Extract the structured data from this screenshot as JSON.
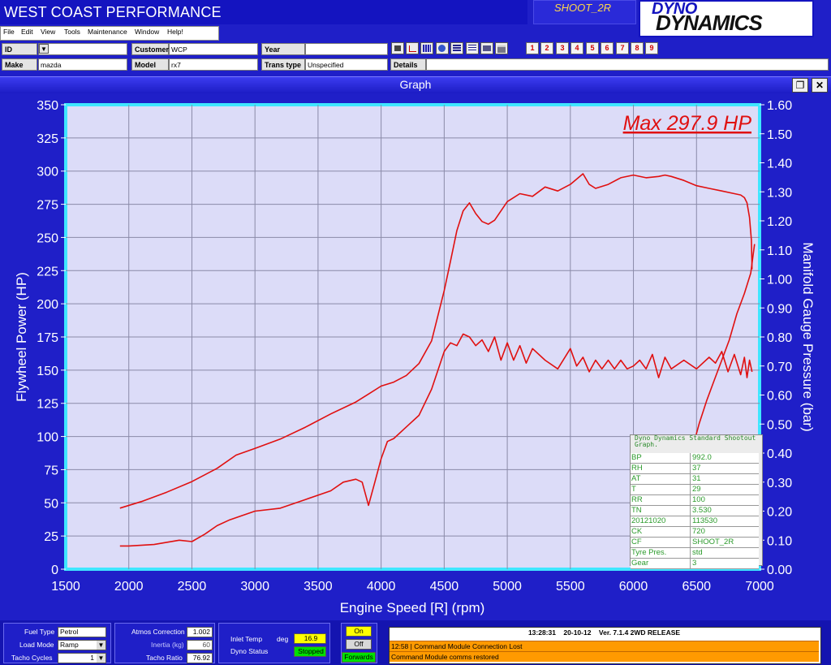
{
  "app": {
    "title": "WEST COAST PERFORMANCE",
    "shoot_label": "SHOOT_2R",
    "logo_top": "DYNO",
    "logo_bottom": "DYNAMICS"
  },
  "menu": [
    "File",
    "Edit",
    "View",
    "Tools",
    "Maintenance",
    "Window",
    "Help!"
  ],
  "form": {
    "id_label": "ID",
    "id_value": "",
    "customer_label": "Customer",
    "customer_value": "WCP",
    "year_label": "Year",
    "year_value": "",
    "make_label": "Make",
    "make_value": "mazda",
    "model_label": "Model",
    "model_value": "rx7",
    "trans_label": "Trans type",
    "trans_value": "Unspecified",
    "details_label": "Details",
    "details_value": ""
  },
  "number_buttons": [
    "1",
    "2",
    "3",
    "4",
    "5",
    "6",
    "7",
    "8",
    "9"
  ],
  "graph_window": {
    "title": "Graph",
    "restore_icon": "restore-icon",
    "close_icon": "close-icon"
  },
  "chart_data": {
    "type": "line",
    "xlabel": "Engine Speed [R] (rpm)",
    "ylabel": "Flywheel Power (HP)",
    "y2label": "Manifold Gauge Pressure (bar)",
    "annotation": "Max 297.9 HP",
    "xlim": [
      1500,
      7000
    ],
    "ylim": [
      0,
      350
    ],
    "y2lim": [
      0,
      1.6
    ],
    "x_ticks": [
      "1500",
      "2000",
      "2500",
      "3000",
      "3500",
      "4000",
      "4500",
      "5000",
      "5500",
      "6000",
      "6500",
      "7000"
    ],
    "y_ticks": [
      "0",
      "25",
      "50",
      "75",
      "100",
      "125",
      "150",
      "175",
      "200",
      "225",
      "250",
      "275",
      "300",
      "325",
      "350"
    ],
    "y2_ticks": [
      "0.00",
      "0.10",
      "0.20",
      "0.30",
      "0.40",
      "0.50",
      "0.60",
      "0.70",
      "0.80",
      "0.90",
      "1.00",
      "1.10",
      "1.20",
      "1.30",
      "1.40",
      "1.50",
      "1.60"
    ],
    "grid": true,
    "colors": {
      "series": "#e01010",
      "plot_bg": "#dcdcf8",
      "axes_border": "#3fe6ff",
      "text": "#ffffff"
    },
    "series": [
      {
        "axis": "left",
        "x": [
          1930,
          2100,
          2300,
          2500,
          2700,
          2850,
          3000,
          3200,
          3400,
          3600,
          3800,
          3900,
          4000,
          4100,
          4200,
          4300,
          4400,
          4500,
          4550,
          4600,
          4650,
          4700,
          4750,
          4800,
          4850,
          4900,
          5000,
          5100,
          5200,
          5300,
          5400,
          5500,
          5600,
          5650,
          5700,
          5800,
          5900,
          6000,
          6100,
          6200,
          6250,
          6300,
          6400,
          6500,
          6600,
          6700,
          6800,
          6850,
          6880,
          6900,
          6920,
          6935,
          6940
        ],
        "y": [
          46,
          51,
          58,
          66,
          76,
          86,
          91,
          98,
          107,
          117,
          126,
          132,
          138,
          141,
          146,
          155,
          172,
          210,
          232,
          255,
          270,
          276,
          268,
          262,
          260,
          263,
          277,
          283,
          281,
          288,
          285,
          290,
          298,
          290,
          287,
          290,
          295,
          297,
          295,
          296,
          297,
          296,
          293,
          289,
          287,
          285,
          283,
          282,
          280,
          276,
          265,
          248,
          226
        ]
      },
      {
        "axis": "right",
        "x": [
          1930,
          2000,
          2200,
          2400,
          2500,
          2600,
          2700,
          2800,
          3000,
          3200,
          3400,
          3600,
          3700,
          3800,
          3850,
          3900,
          3950,
          4000,
          4050,
          4100,
          4200,
          4300,
          4400,
          4500,
          4550,
          4600,
          4650,
          4700,
          4750,
          4800,
          4850,
          4900,
          4950,
          5000,
          5050,
          5100,
          5150,
          5200,
          5300,
          5400,
          5500,
          5550,
          5600,
          5650,
          5700,
          5750,
          5800,
          5850,
          5900,
          5950,
          6000,
          6050,
          6100,
          6150,
          6200,
          6250,
          6300,
          6400,
          6500,
          6600,
          6650,
          6700,
          6750,
          6800,
          6850,
          6880,
          6900,
          6920,
          6940
        ],
        "y": [
          0.08,
          0.08,
          0.085,
          0.1,
          0.095,
          0.12,
          0.15,
          0.17,
          0.2,
          0.21,
          0.24,
          0.27,
          0.3,
          0.31,
          0.3,
          0.22,
          0.3,
          0.38,
          0.44,
          0.45,
          0.49,
          0.53,
          0.62,
          0.75,
          0.78,
          0.77,
          0.81,
          0.8,
          0.77,
          0.79,
          0.75,
          0.8,
          0.72,
          0.78,
          0.72,
          0.77,
          0.71,
          0.76,
          0.72,
          0.69,
          0.76,
          0.7,
          0.73,
          0.68,
          0.72,
          0.69,
          0.72,
          0.69,
          0.72,
          0.69,
          0.7,
          0.72,
          0.69,
          0.74,
          0.66,
          0.73,
          0.69,
          0.72,
          0.69,
          0.73,
          0.71,
          0.75,
          0.68,
          0.74,
          0.67,
          0.73,
          0.66,
          0.72,
          0.68
        ]
      },
      {
        "axis": "right",
        "x": [
          6960,
          6930,
          6880,
          6820,
          6760,
          6700,
          6640,
          6580,
          6520,
          6470,
          6430,
          6400,
          6380,
          6365
        ],
        "y": [
          1.12,
          1.02,
          0.95,
          0.88,
          0.79,
          0.72,
          0.65,
          0.58,
          0.5,
          0.42,
          0.33,
          0.25,
          0.15,
          0.0
        ]
      }
    ]
  },
  "data_table": {
    "header": "Dyno Dynamics Standard Shootout Graph.",
    "rows": [
      {
        "k": "BP",
        "v": "992.0"
      },
      {
        "k": "RH",
        "v": "37"
      },
      {
        "k": "AT",
        "v": "31"
      },
      {
        "k": "T",
        "v": "29"
      },
      {
        "k": "RR",
        "v": "100"
      },
      {
        "k": "TN",
        "v": "3.530"
      },
      {
        "k": "20121020",
        "v": "113530"
      },
      {
        "k": "CK",
        "v": "720"
      },
      {
        "k": "CF",
        "v": "SHOOT_2R"
      },
      {
        "k": "Tyre Pres.",
        "v": "std"
      },
      {
        "k": "Gear",
        "v": "3"
      }
    ]
  },
  "bottom": {
    "fuel_type_label": "Fuel Type",
    "fuel_type_value": "Petrol",
    "load_mode_label": "Load Mode",
    "load_mode_value": "Ramp",
    "tacho_cycles_label": "Tacho Cycles",
    "tacho_cycles_value": "1",
    "atmos_label": "Atmos Correction",
    "atmos_value": "1.002",
    "inertia_label": "Inertia (kg)",
    "inertia_value": "60",
    "tacho_ratio_label": "Tacho Ratio",
    "tacho_ratio_value": "76.92",
    "inlet_label": "Inlet Temp",
    "inlet_unit": "deg",
    "inlet_value": "16.9",
    "dyno_status_label": "Dyno Status",
    "dyno_status_value": "Stopped",
    "on_label": "On",
    "off_label": "Off",
    "forwards_label": "Forwards",
    "status_time": "13:28:31",
    "status_date": "20-10-12",
    "status_version": "Ver.  7.1.4 2WD RELEASE",
    "messages": [
      "12:58 | Command Module Connection Lost",
      "Command Module comms restored"
    ],
    "colors": {
      "on": "#ffff00",
      "stopped": "#00e000",
      "msg": "#ff9a00"
    }
  }
}
